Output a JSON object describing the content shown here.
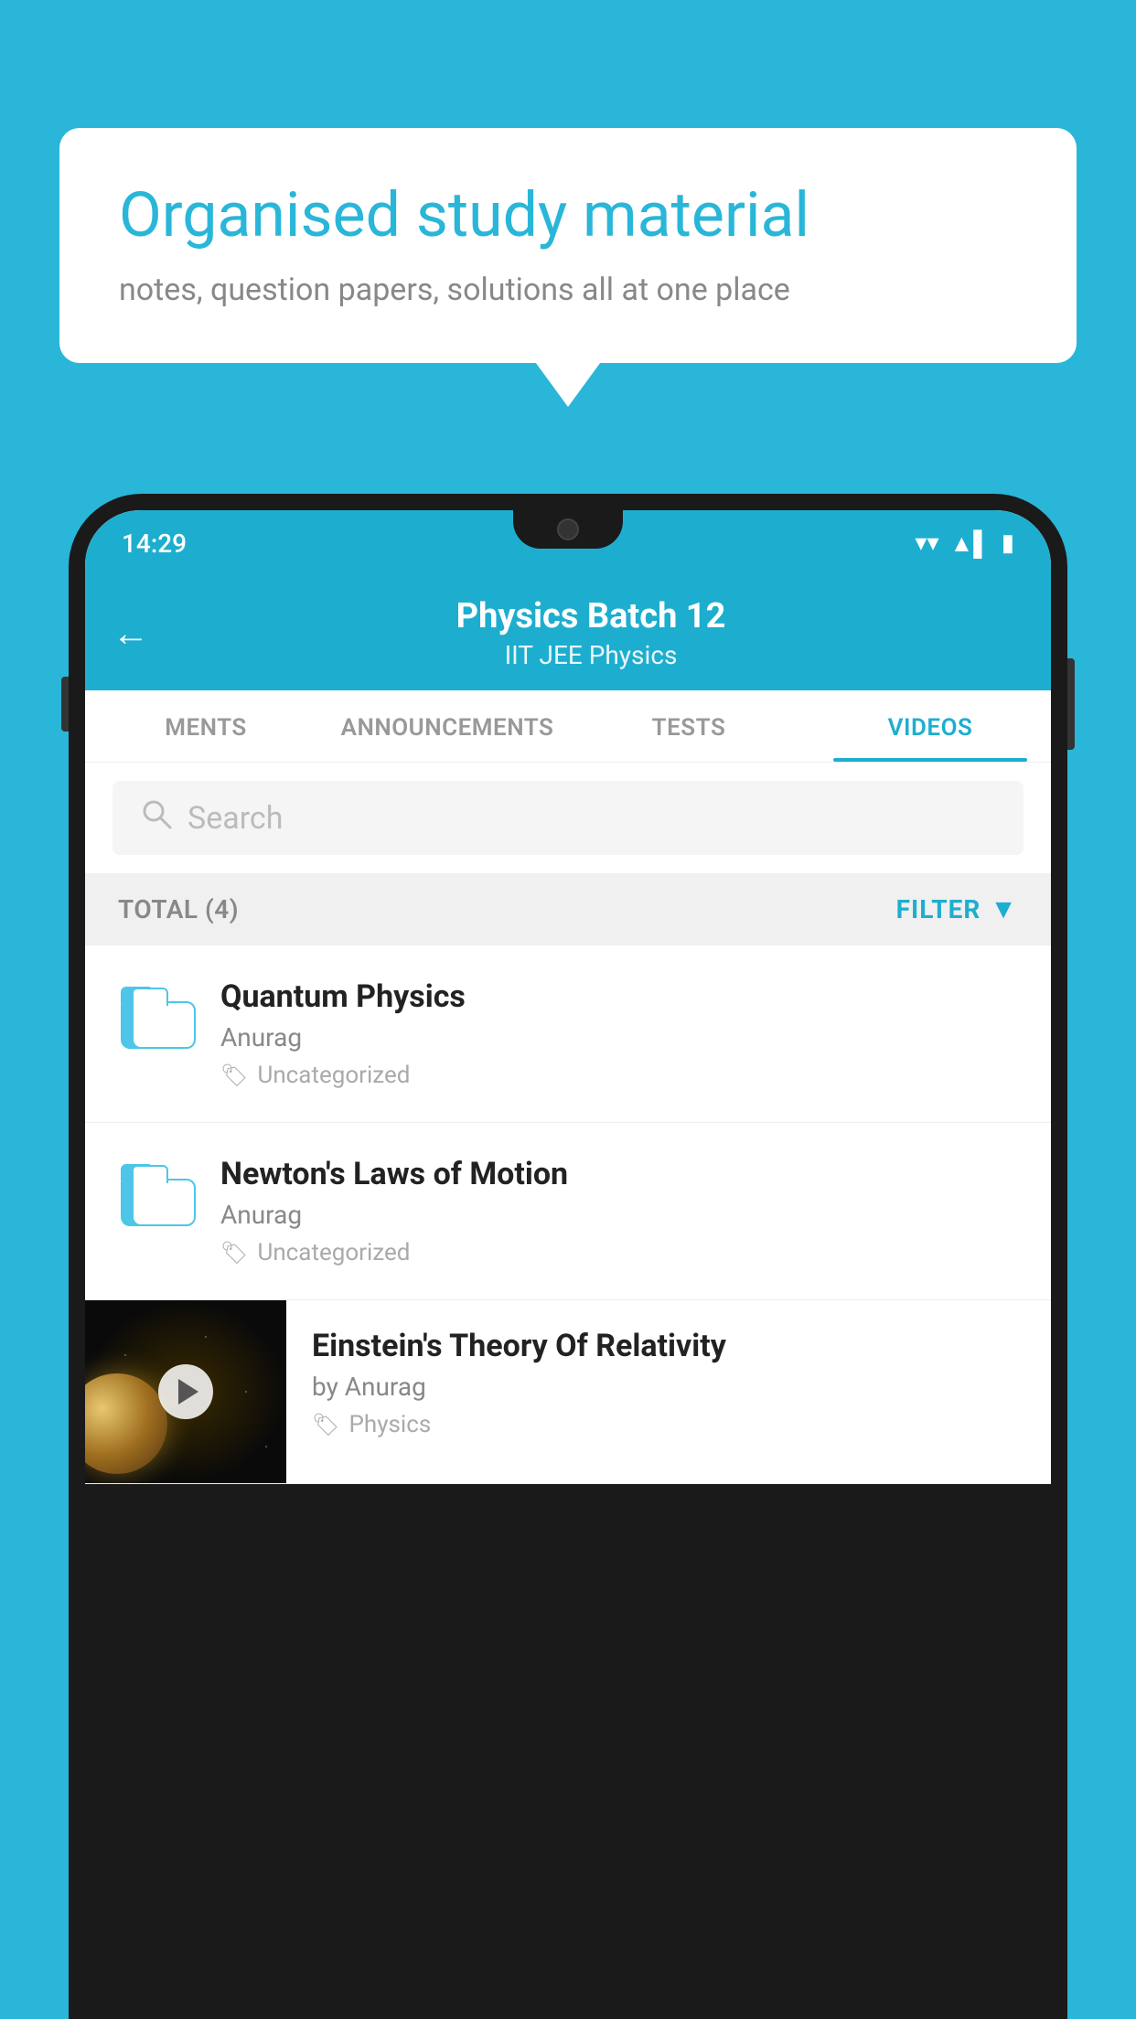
{
  "background_color": "#29B6D8",
  "speech_bubble": {
    "title": "Organised study material",
    "subtitle": "notes, question papers, solutions all at one place"
  },
  "phone": {
    "status_bar": {
      "time": "14:29",
      "wifi_icon": "▼",
      "signal_icon": "▲",
      "battery_icon": "▮"
    },
    "header": {
      "back_label": "←",
      "title": "Physics Batch 12",
      "tags": "IIT JEE   Physics"
    },
    "tabs": [
      {
        "label": "MENTS",
        "active": false
      },
      {
        "label": "ANNOUNCEMENTS",
        "active": false
      },
      {
        "label": "TESTS",
        "active": false
      },
      {
        "label": "VIDEOS",
        "active": true
      }
    ],
    "search": {
      "placeholder": "Search"
    },
    "filter_bar": {
      "total_label": "TOTAL (4)",
      "filter_label": "FILTER"
    },
    "videos": [
      {
        "title": "Quantum Physics",
        "author": "Anurag",
        "tag": "Uncategorized",
        "type": "folder"
      },
      {
        "title": "Newton's Laws of Motion",
        "author": "Anurag",
        "tag": "Uncategorized",
        "type": "folder"
      },
      {
        "title": "Einstein's Theory Of Relativity",
        "author": "by Anurag",
        "tag": "Physics",
        "type": "video"
      }
    ]
  }
}
